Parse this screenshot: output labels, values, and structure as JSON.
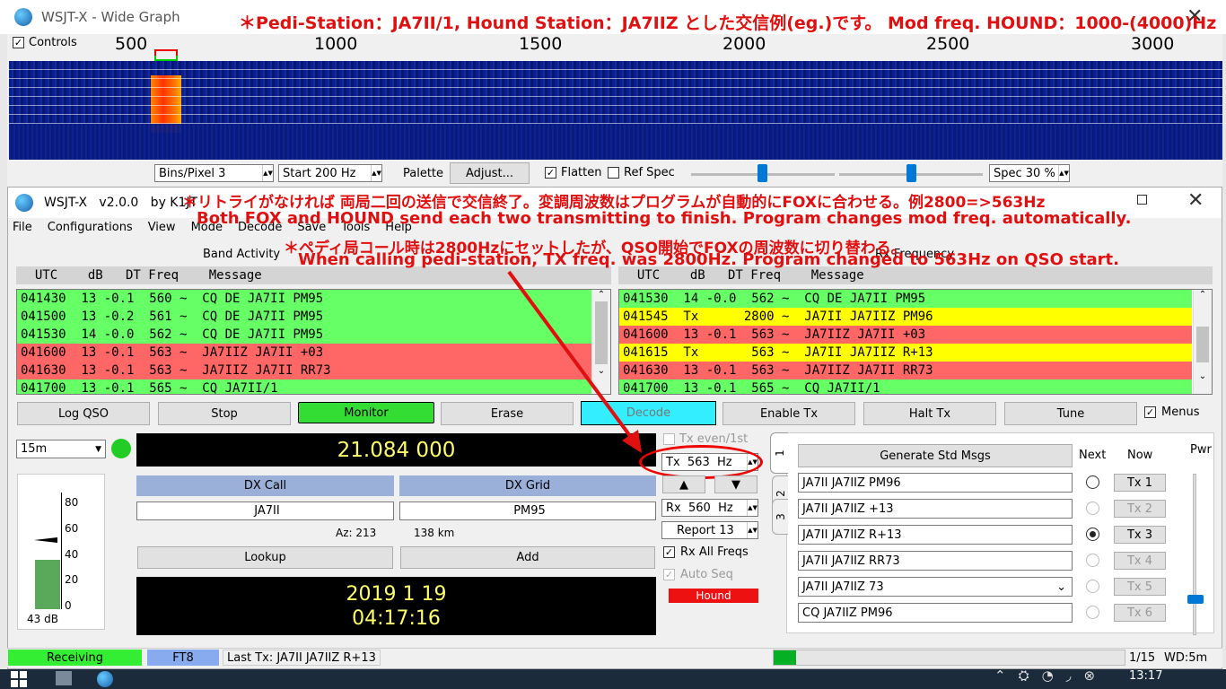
{
  "wide_graph": {
    "title": "WSJT-X - Wide Graph",
    "controls_label": "Controls",
    "freq_labels": [
      "500",
      "1000",
      "1500",
      "2000",
      "2500",
      "3000"
    ],
    "bins_pixel": "Bins/Pixel  3",
    "start": "Start 200 Hz",
    "palette_label": "Palette",
    "adjust_label": "Adjust...",
    "flatten_label": "Flatten",
    "ref_spec_label": "Ref Spec",
    "spec": "Spec 30 %"
  },
  "annotations": {
    "top": "＊Pedi-Station：JA7II/1, Hound Station：JA7IIZ とした交信例(eg.)です。 Mod freq. HOUND：1000-(4000)Hz",
    "jp1": "＊リトライがなければ 両局二回の送信で交信終了。変調周波数はプログラムが自動的にFOXに合わせる。例2800=>563Hz",
    "en1": "Both FOX and HOUND send each two transmitting to finish. Program changes mod freq. automatically.",
    "jp2": "＊ペディ局コール時は2800Hzにセットしたが、QSO開始でFOXの周波数に切り替わる。",
    "en2": "When calling pedi-station, TX freq. was 2800Hz. Program changed to 563Hz on QSO start."
  },
  "main": {
    "title": "WSJT-X   v2.0.0   by K1JT",
    "menu": [
      "File",
      "Configurations",
      "View",
      "Mode",
      "Decode",
      "Save",
      "Tools",
      "Help"
    ],
    "band_activity_label": "Band Activity",
    "rx_frequency_label": "Rx Frequency",
    "header": "  UTC    dB   DT Freq    Message",
    "band_rows": [
      {
        "text": "041430  13 -0.1  560 ~  CQ DE JA7II PM95",
        "color": "green"
      },
      {
        "text": "041500  13 -0.2  561 ~  CQ DE JA7II PM95",
        "color": "green"
      },
      {
        "text": "041530  14 -0.0  562 ~  CQ DE JA7II PM95",
        "color": "green"
      },
      {
        "text": "041600  13 -0.1  563 ~  JA7IIZ JA7II +03",
        "color": "red"
      },
      {
        "text": "041630  13 -0.1  563 ~  JA7IIZ JA7II RR73",
        "color": "red"
      },
      {
        "text": "041700  13 -0.1  565 ~  CQ JA7II/1",
        "color": "green"
      }
    ],
    "rx_rows": [
      {
        "text": "041530  14 -0.0  562 ~  CQ DE JA7II PM95",
        "color": "green"
      },
      {
        "text": "041545  Tx      2800 ~  JA7II JA7IIZ PM96",
        "color": "yellow"
      },
      {
        "text": "041600  13 -0.1  563 ~  JA7IIZ JA7II +03",
        "color": "red"
      },
      {
        "text": "041615  Tx       563 ~  JA7II JA7IIZ R+13",
        "color": "yellow"
      },
      {
        "text": "041630  13 -0.1  563 ~  JA7IIZ JA7II RR73",
        "color": "red"
      },
      {
        "text": "041700  13 -0.1  565 ~  CQ JA7II/1",
        "color": "green"
      }
    ],
    "buttons": {
      "log_qso": "Log QSO",
      "stop": "Stop",
      "monitor": "Monitor",
      "erase": "Erase",
      "decode": "Decode",
      "enable_tx": "Enable Tx",
      "halt_tx": "Halt Tx",
      "tune": "Tune",
      "menus": "Menus"
    },
    "band": "15m",
    "frequency": "21.084 000",
    "tx_even": "Tx even/1st",
    "tx_freq": "Tx  563  Hz",
    "rx_freq": "Rx  560  Hz",
    "report": "Report 13",
    "rx_all_freqs": "Rx All Freqs",
    "auto_seq": "Auto Seq",
    "hound": "Hound",
    "dx_call_label": "DX Call",
    "dx_grid_label": "DX Grid",
    "dx_call": "JA7II",
    "dx_grid": "PM95",
    "az": "Az: 213",
    "distance": "138 km",
    "lookup": "Lookup",
    "add": "Add",
    "date": "2019 1 19",
    "time": "04:17:16",
    "meter_ticks": [
      "80",
      "60",
      "40",
      "20",
      "0"
    ],
    "meter_db": "43 dB",
    "meter_level": 0.42,
    "tabs": [
      "1",
      "2",
      "3"
    ],
    "generate_std_msgs": "Generate Std Msgs",
    "next_label": "Next",
    "now_label": "Now",
    "messages": [
      {
        "text": "JA7II JA7IIZ PM96",
        "tx": "Tx 1"
      },
      {
        "text": "JA7II JA7IIZ +13",
        "tx": "Tx 2"
      },
      {
        "text": "JA7II JA7IIZ R+13",
        "tx": "Tx 3"
      },
      {
        "text": "JA7II JA7IIZ RR73",
        "tx": "Tx 4"
      },
      {
        "text": "JA7II JA7IIZ 73",
        "tx": "Tx 5"
      },
      {
        "text": "CQ JA7IIZ PM96",
        "tx": "Tx 6"
      }
    ],
    "pwr_label": "Pwr",
    "status": {
      "receiving": "Receiving",
      "mode": "FT8",
      "last_tx": "Last Tx: JA7II JA7IIZ R+13",
      "progress": "1/15",
      "wd": "WD:5m"
    }
  },
  "taskbar": {
    "time": "13:17"
  }
}
